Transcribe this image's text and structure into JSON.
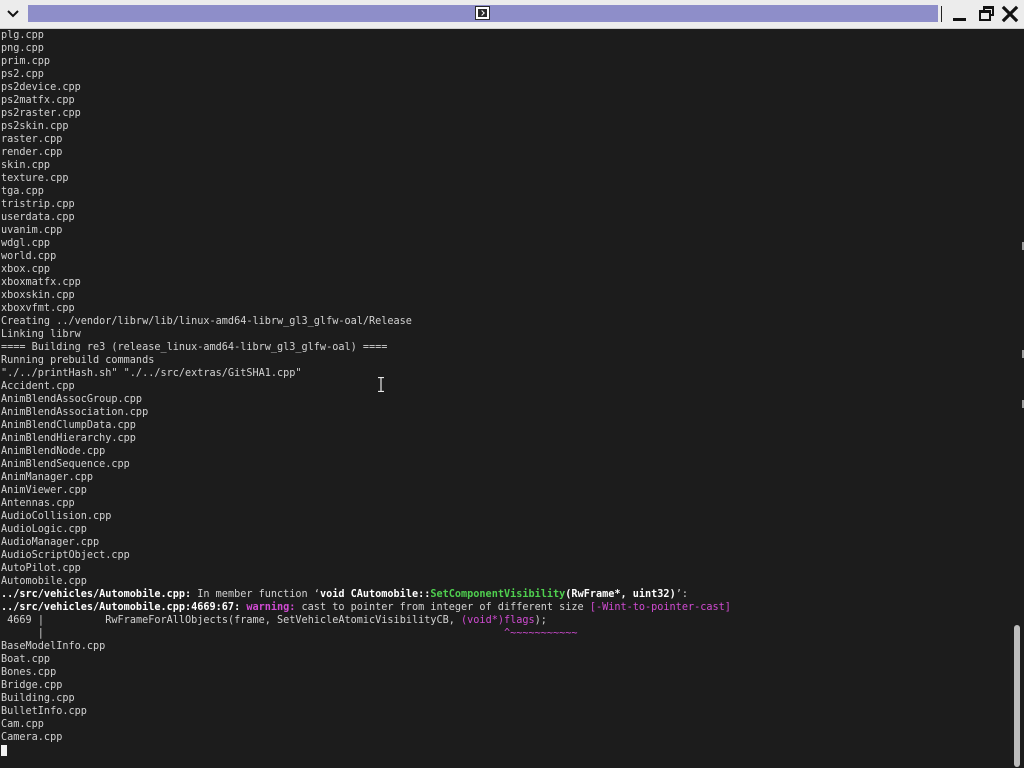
{
  "window": {
    "title": "",
    "app_icon": "terminal-icon",
    "menu_icon": "chevron-down-icon",
    "controls": [
      "minimize-icon",
      "maximize-icon",
      "close-icon"
    ]
  },
  "terminal": {
    "plain_lines_top": [
      "plg.cpp",
      "png.cpp",
      "prim.cpp",
      "ps2.cpp",
      "ps2device.cpp",
      "ps2matfx.cpp",
      "ps2raster.cpp",
      "ps2skin.cpp",
      "raster.cpp",
      "render.cpp",
      "skin.cpp",
      "texture.cpp",
      "tga.cpp",
      "tristrip.cpp",
      "userdata.cpp",
      "uvanim.cpp",
      "wdgl.cpp",
      "world.cpp",
      "xbox.cpp",
      "xboxmatfx.cpp",
      "xboxskin.cpp",
      "xboxvfmt.cpp",
      "Creating ../vendor/librw/lib/linux-amd64-librw_gl3_glfw-oal/Release",
      "Linking librw",
      "==== Building re3 (release_linux-amd64-librw_gl3_glfw-oal) ====",
      "Running prebuild commands",
      "\"./../printHash.sh\" \"./../src/extras/GitSHA1.cpp\"",
      "Accident.cpp",
      "AnimBlendAssocGroup.cpp",
      "AnimBlendAssociation.cpp",
      "AnimBlendClumpData.cpp",
      "AnimBlendHierarchy.cpp",
      "AnimBlendNode.cpp",
      "AnimBlendSequence.cpp",
      "AnimManager.cpp",
      "AnimViewer.cpp",
      "Antennas.cpp",
      "AudioCollision.cpp",
      "AudioLogic.cpp",
      "AudioManager.cpp",
      "AudioScriptObject.cpp",
      "AutoPilot.cpp",
      "Automobile.cpp"
    ],
    "diag1": {
      "path": "../src/vehicles/Automobile.cpp:",
      "text_a": " In member function ‘",
      "sig_a": "void CAutomobile::",
      "sig_fn": "SetComponentVisibility",
      "sig_b": "(RwFrame*, uint32)",
      "text_b": "’:"
    },
    "diag2": {
      "path": "../src/vehicles/Automobile.cpp:4669:67:",
      "warning_label": " warning:",
      "message": " cast to pointer from integer of different size ",
      "flag": "[-Wint-to-pointer-cast]"
    },
    "code_line": {
      "lineno": " 4669 ",
      "bar": "|",
      "code_a": "          RwFrameForAllObjects(frame, SetVehicleAtomicVisibilityCB, ",
      "code_hl": "(void*)flags",
      "code_b": ");"
    },
    "marker_line": {
      "bar": "      |",
      "marker": "                                                                           ^~~~~~~~~~~~"
    },
    "plain_lines_bottom": [
      "BaseModelInfo.cpp",
      "Boat.cpp",
      "Bones.cpp",
      "Bridge.cpp",
      "Building.cpp",
      "BulletInfo.cpp",
      "Cam.cpp",
      "Camera.cpp"
    ]
  },
  "colors": {
    "background": "#1c1c1c",
    "text": "#d2d2d2",
    "title_bar": "#ececec",
    "title_field": "#8e8ec9",
    "warning": "#d04bd2",
    "highlight_green": "#4fcf4f"
  }
}
